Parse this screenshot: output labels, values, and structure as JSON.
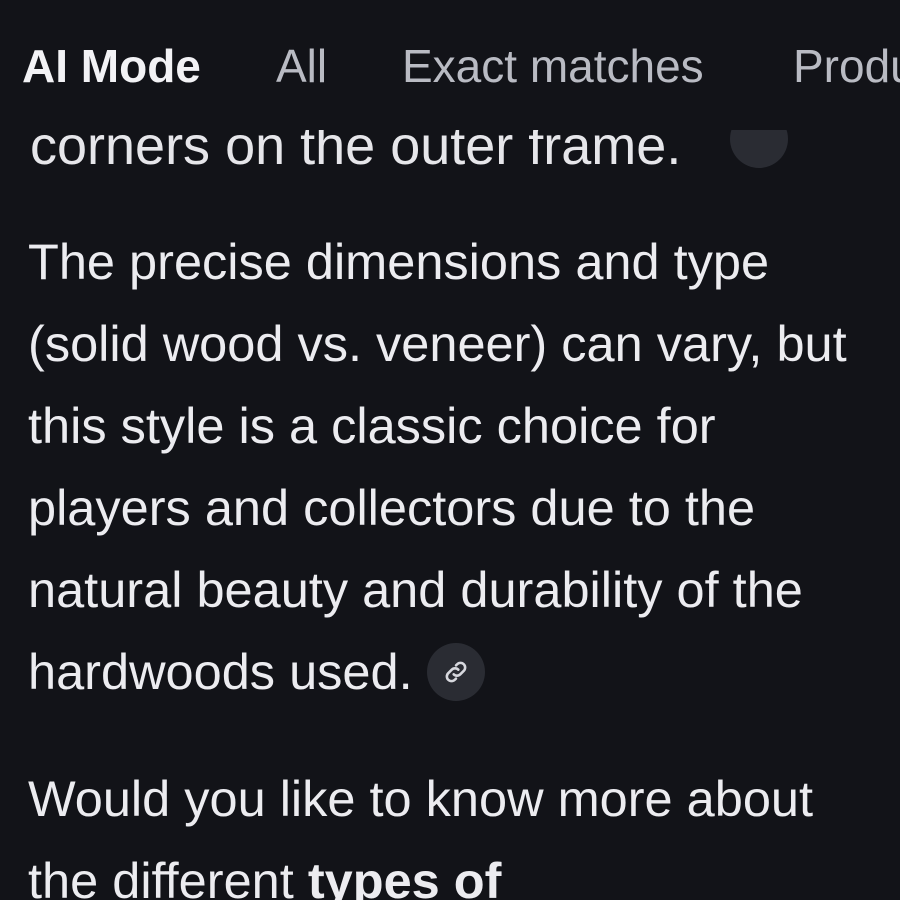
{
  "tabs": {
    "ai_mode": "AI Mode",
    "all": "All",
    "exact_matches": "Exact matches",
    "products": "Products"
  },
  "answer": {
    "clipped_line": "corners on the outer frame.",
    "paragraph_1": "The precise dimensions and type (solid wood vs. veneer) can vary, but this style is a classic choice for players and collectors due to the natural beauty and durability of the hardwoods used.",
    "paragraph_2_start": "Would you like to know more about the different ",
    "paragraph_2_bold": "types of"
  },
  "icons": {
    "source_link": "link-icon"
  },
  "colors": {
    "background": "#121318",
    "text": "#ececf0",
    "chip": "#2a2c33"
  }
}
